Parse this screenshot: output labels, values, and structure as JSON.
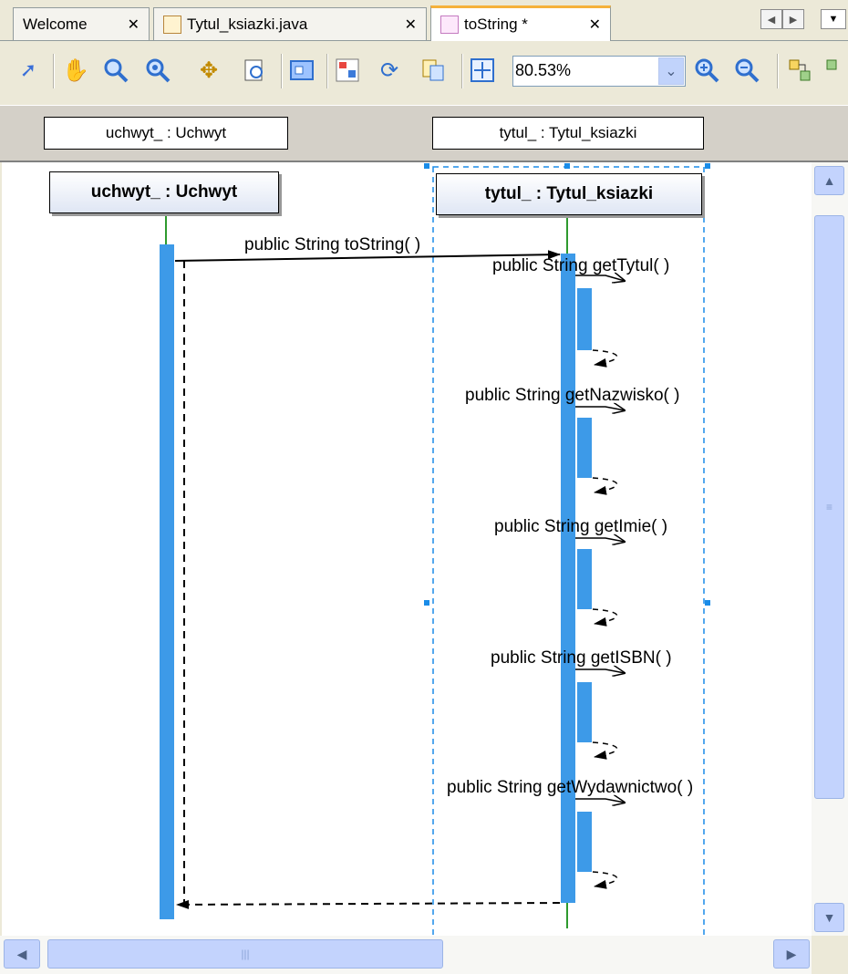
{
  "tabs": [
    {
      "label": "Welcome",
      "close": "✕"
    },
    {
      "label": "Tytul_ksiazki.java",
      "close": "✕"
    },
    {
      "label": "toString *",
      "close": "✕"
    }
  ],
  "toolbar": {
    "zoom_value": "80.53%",
    "icons": [
      "select-icon",
      "pan-hand-icon",
      "zoom-icon",
      "zoom-region-icon",
      "move-icon",
      "fit-page-icon",
      "marquee-icon",
      "layout-icon",
      "refresh-icon",
      "copy-diagram-icon",
      "fit-diagram-icon",
      "zoom-in-icon",
      "zoom-out-icon",
      "expand-icon"
    ]
  },
  "header": {
    "lifeline1": "uchwyt_ : Uchwyt",
    "lifeline2": "tytul_ : Tytul_ksiazki"
  },
  "diagram": {
    "object1": "uchwyt_ : Uchwyt",
    "object2": "tytul_ : Tytul_ksiazki",
    "messages": {
      "m0": "public String  toString( )",
      "m1": "public String  getTytul( )",
      "m2": "public String  getNazwisko( )",
      "m3": "public String  getImie( )",
      "m4": "public String  getISBN( )",
      "m5": "public String  getWydawnictwo( )"
    },
    "colors": {
      "activation": "#3d9ae8",
      "lifeline": "#2e9a2e",
      "selection": "#1a8ce8"
    }
  }
}
